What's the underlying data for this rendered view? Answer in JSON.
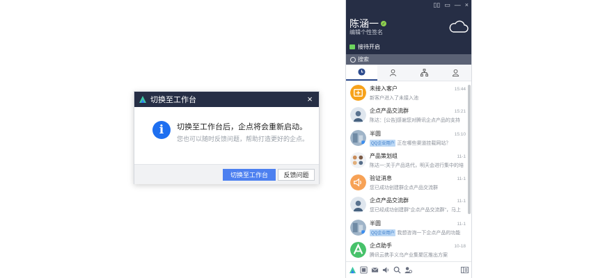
{
  "dialog": {
    "title": "切换至工作台",
    "close": "×",
    "icon_glyph": "i",
    "main_text": "切换至工作台后，企点将会重新启动。",
    "sub_text": "您也可以随时反馈问题，帮助打造更好的企点。",
    "primary_button": "切换至工作台",
    "secondary_button": "反馈问题"
  },
  "panel": {
    "user_name": "陈涵一",
    "signature": "编辑个性签名",
    "reception": "接待开启",
    "search_placeholder": "搜索",
    "top_icons": [
      "book-icon",
      "chat-icon",
      "minimize-icon",
      "close-icon"
    ],
    "top_icon_glyphs": [
      "▯▯",
      "▭",
      "—",
      "×"
    ],
    "items": [
      {
        "name": "未接入客户",
        "time": "15:44",
        "tag": "",
        "msg": "新客户进入了未接入池",
        "avatar": "customer"
      },
      {
        "name": "企点产品交流群",
        "time": "15:21",
        "tag": "",
        "msg": "陈达：[公告]感谢您对腾讯企点产品的支持",
        "avatar": "person"
      },
      {
        "name": "半圆",
        "time": "15:10",
        "tag": "QQ企业用户",
        "msg": "正在哪些渠道挂载网站？",
        "avatar": "photo"
      },
      {
        "name": "产品策划组",
        "time": "11-1",
        "tag": "",
        "msg": "陈达一:关于产品迭代，明天会进行集中的培",
        "avatar": "group"
      },
      {
        "name": "验证消息",
        "time": "11-1",
        "tag": "",
        "msg": "您已成功创建群企点产品交流群",
        "avatar": "speaker"
      },
      {
        "name": "企点产品交流群",
        "time": "11-1",
        "tag": "",
        "msg": "您已经成功创建群\"企点产品交流群\"，马上",
        "avatar": "person"
      },
      {
        "name": "半圆",
        "time": "11-1",
        "tag": "QQ企业用户",
        "msg": "我想咨询一下企点产品的功能",
        "avatar": "photo"
      },
      {
        "name": "企点助手",
        "time": "10-18",
        "tag": "",
        "msg": "腾讯云携手义乌产业集聚区推出方案",
        "avatar": "assistant"
      }
    ]
  },
  "colors": {
    "header_bg": "#262e45",
    "primary_blue": "#4d80f0",
    "info_blue": "#1e6ff0",
    "status_green": "#8fd14f"
  }
}
